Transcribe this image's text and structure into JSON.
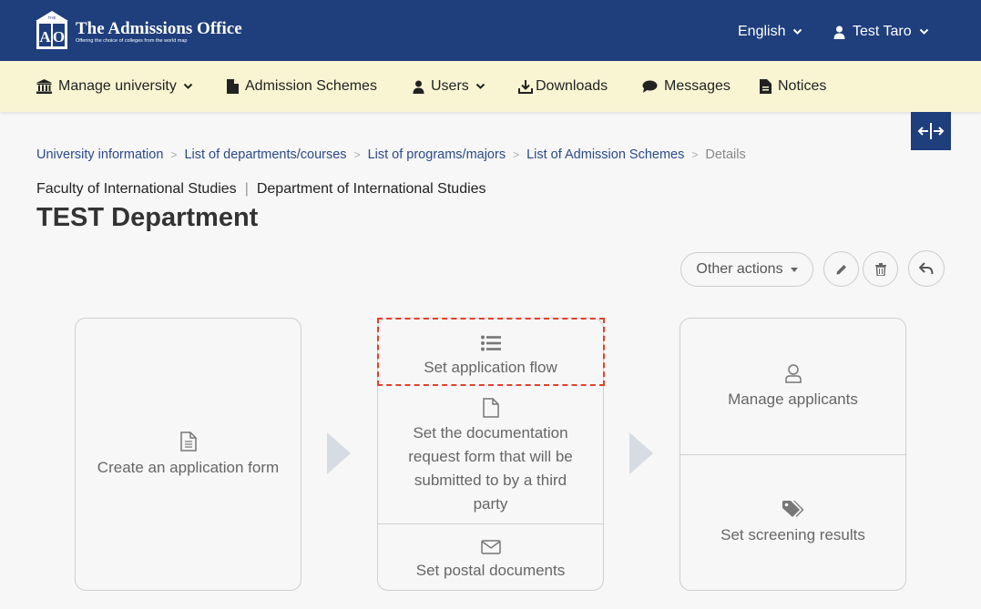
{
  "header": {
    "logo_letters": "AO",
    "logo_small": "THE",
    "brand_title": "The Admissions Office",
    "brand_tagline": "Offering the choice of colleges from the world map",
    "language": "English",
    "user_name": "Test Taro",
    "color": "#1e3e7c"
  },
  "nav": {
    "background": "#f9f5d3",
    "items": [
      {
        "label": "Manage university",
        "icon": "university-icon",
        "dropdown": true
      },
      {
        "label": "Admission Schemes",
        "icon": "file-icon",
        "dropdown": false
      },
      {
        "label": "Users",
        "icon": "user-icon",
        "dropdown": true
      },
      {
        "label": "Downloads",
        "icon": "download-icon",
        "dropdown": false
      },
      {
        "label": "Messages",
        "icon": "comment-icon",
        "dropdown": false
      },
      {
        "label": "Notices",
        "icon": "file-text-icon",
        "dropdown": false
      }
    ]
  },
  "breadcrumb": {
    "items": [
      "University information",
      "List of departments/courses",
      "List of programs/majors",
      "List of Admission Schemes"
    ],
    "current": "Details",
    "separator": ">"
  },
  "org": {
    "faculty": "Faculty of International Studies",
    "separator": "|",
    "department": "Department of International Studies"
  },
  "page_title": "TEST Department",
  "actions": {
    "other_actions": "Other actions"
  },
  "flow": {
    "step1": {
      "label": "Create an application form"
    },
    "step2": {
      "set_flow": "Set application flow",
      "doc_request": "Set the documentation request form that will be submitted to by a third party",
      "postal": "Set postal documents"
    },
    "step3": {
      "manage_applicants": "Manage applicants",
      "screening": "Set screening results"
    },
    "highlight_color": "#e0412e"
  }
}
